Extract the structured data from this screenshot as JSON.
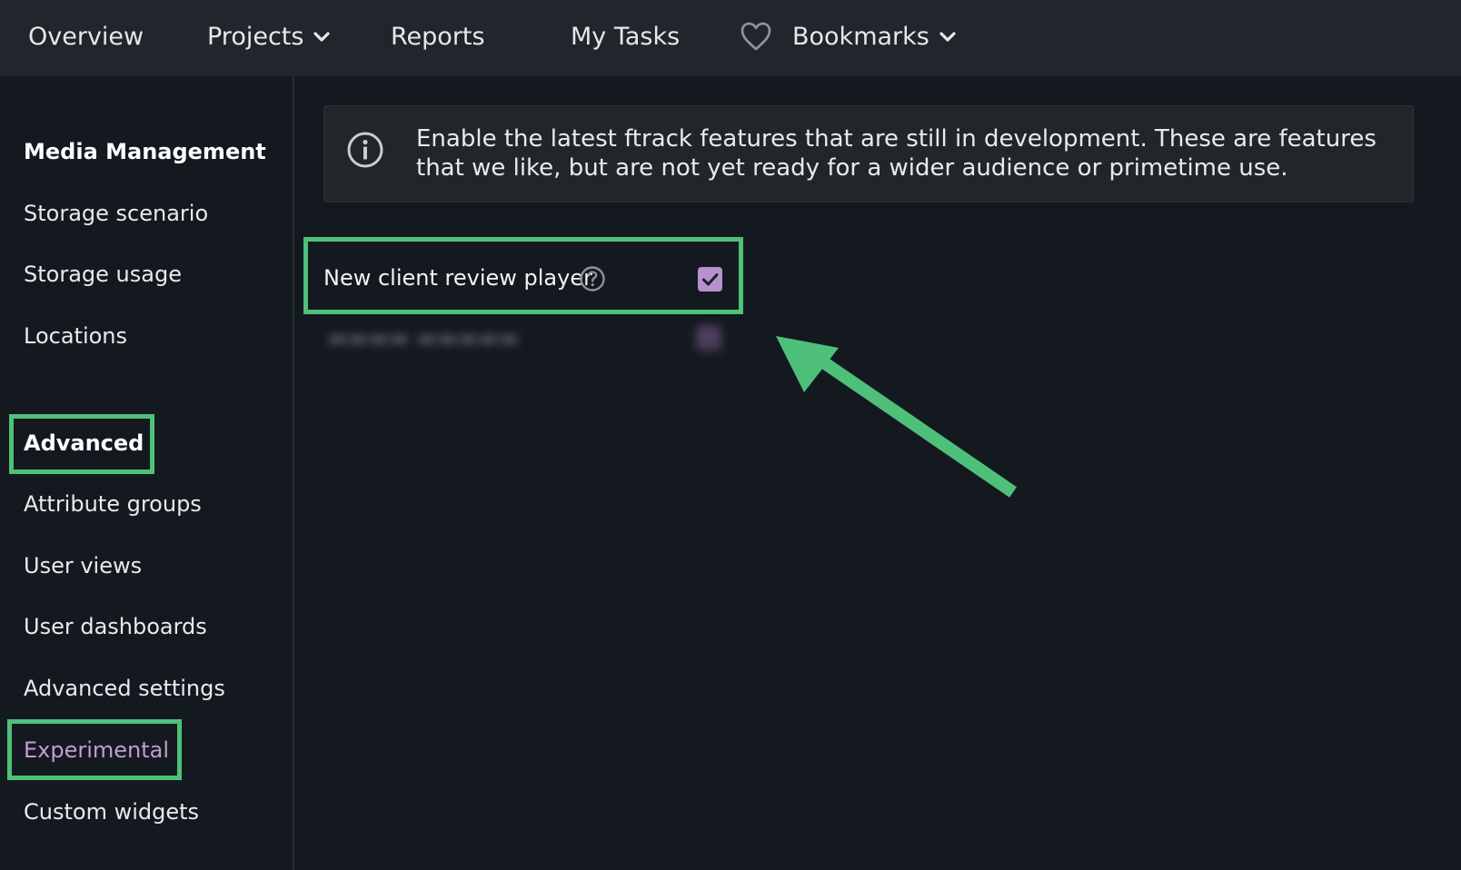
{
  "nav": {
    "overview": "Overview",
    "projects": "Projects",
    "reports": "Reports",
    "my_tasks": "My Tasks",
    "bookmarks": "Bookmarks"
  },
  "sidebar": {
    "media_heading": "Media Management",
    "media_items": [
      "Storage scenario",
      "Storage usage",
      "Locations"
    ],
    "advanced_heading": "Advanced",
    "advanced_items": [
      "Attribute groups",
      "User views",
      "User dashboards",
      "Advanced settings",
      "Experimental",
      "Custom widgets"
    ],
    "active_item": "Experimental"
  },
  "info": {
    "text": "Enable the latest ftrack features that are still in development. These are features that we like, but are not yet ready for a wider audience or primetime use."
  },
  "features": [
    {
      "label": "New client review player",
      "checked": true
    }
  ],
  "icons": {
    "info": "info-circle-icon",
    "help": "question-circle-icon",
    "heart": "heart-outline-icon",
    "chevron": "chevron-down-icon",
    "check": "checkmark-icon"
  },
  "colors": {
    "background": "#141920",
    "topbar": "#22262c",
    "accent_purple": "#c39bd3",
    "checkbox": "#b791cf",
    "highlight_green": "#4fc07a"
  }
}
